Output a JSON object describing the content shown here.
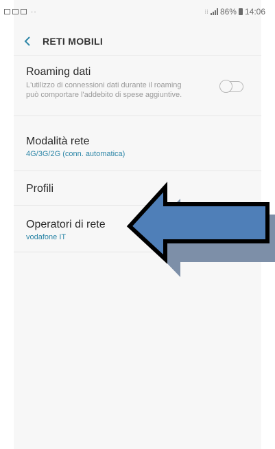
{
  "status_bar": {
    "dots": "··",
    "network_icons": "⁝⁝",
    "battery_percent": "86%",
    "time": "14:06"
  },
  "header": {
    "title": "RETI MOBILI"
  },
  "settings": {
    "roaming": {
      "title": "Roaming dati",
      "description": "L'utilizzo di connessioni dati durante il roaming può comportare l'addebito di spese aggiuntive.",
      "enabled": false
    },
    "network_mode": {
      "title": "Modalità rete",
      "value": "4G/3G/2G (conn. automatica)"
    },
    "profiles": {
      "title": "Profili"
    },
    "operators": {
      "title": "Operatori di rete",
      "value": "vodafone IT"
    }
  },
  "colors": {
    "accent": "#2d86a7",
    "arrow_fill": "#4f7fb8",
    "arrow_shadow": "#7d8fa8"
  }
}
